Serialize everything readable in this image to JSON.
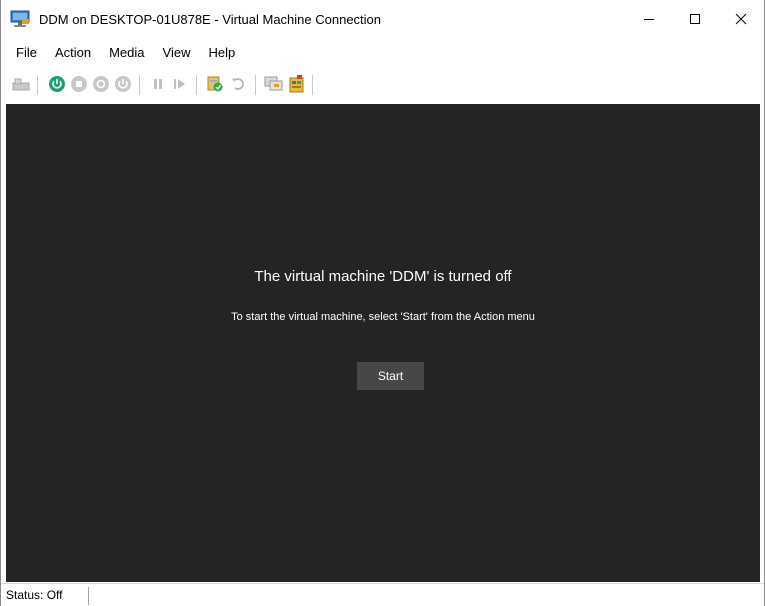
{
  "window": {
    "title": "DDM on DESKTOP-01U878E - Virtual Machine Connection"
  },
  "menu": {
    "items": [
      "File",
      "Action",
      "Media",
      "View",
      "Help"
    ]
  },
  "toolbar": {
    "buttons": [
      {
        "icon": "ctrl-alt-del-icon"
      },
      {
        "icon": "start-icon",
        "color": "#1e9e6e"
      },
      {
        "icon": "turn-off-icon"
      },
      {
        "icon": "shut-down-icon"
      },
      {
        "icon": "save-icon"
      },
      {
        "icon": "pause-icon"
      },
      {
        "icon": "reset-icon"
      },
      {
        "icon": "checkpoint-icon"
      },
      {
        "icon": "revert-icon"
      },
      {
        "icon": "enhanced-session-icon"
      },
      {
        "icon": "share-icon"
      }
    ]
  },
  "display": {
    "heading": "The virtual machine 'DDM' is turned off",
    "subtext": "To start the virtual machine, select 'Start' from the Action menu",
    "start_label": "Start",
    "background": "#242424"
  },
  "status": {
    "text": "Status: Off"
  }
}
